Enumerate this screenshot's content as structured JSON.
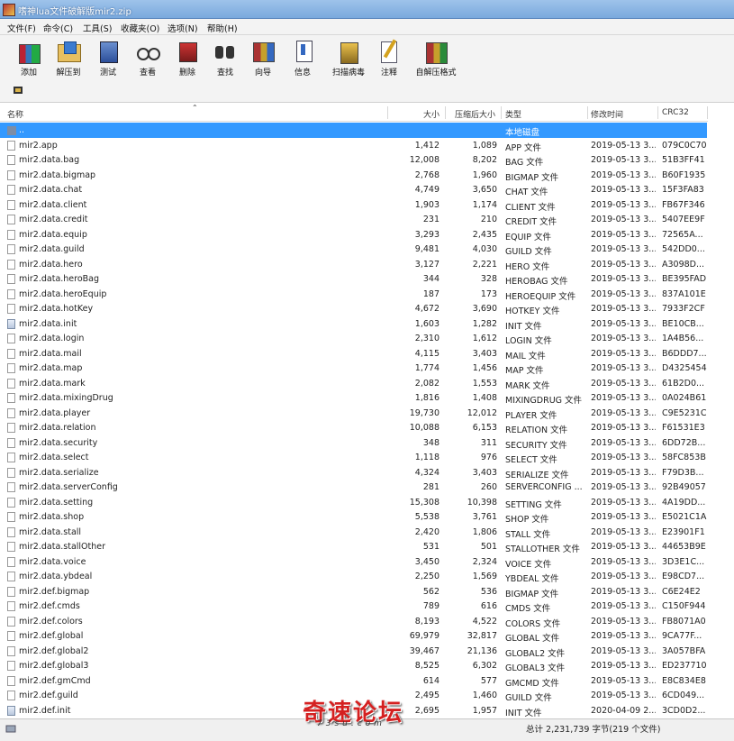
{
  "window": {
    "title": "嗜神lua文件破解版mir2.zip"
  },
  "menu": [
    "文件(F)",
    "命令(C)",
    "工具(S)",
    "收藏夹(O)",
    "选项(N)",
    "帮助(H)"
  ],
  "toolbar": [
    {
      "label": "添加",
      "icon": "add-icon"
    },
    {
      "label": "解压到",
      "icon": "extract-icon"
    },
    {
      "label": "测试",
      "icon": "test-icon"
    },
    {
      "label": "查看",
      "icon": "view-icon"
    },
    {
      "label": "删除",
      "icon": "delete-icon"
    },
    {
      "label": "查找",
      "icon": "find-icon"
    },
    {
      "label": "向导",
      "icon": "wizard-icon"
    },
    {
      "label": "信息",
      "icon": "info-icon"
    },
    {
      "label": "扫描病毒",
      "icon": "scan-virus-icon"
    },
    {
      "label": "注释",
      "icon": "comment-icon"
    },
    {
      "label": "自解压格式",
      "icon": "sfx-icon"
    }
  ],
  "columns": {
    "name": "名称",
    "size": "大小",
    "packed": "压缩后大小",
    "type": "类型",
    "modified": "修改时间",
    "crc": "CRC32"
  },
  "up_row": {
    "name": "..",
    "type": "本地磁盘"
  },
  "files": [
    {
      "name": "mir2.app",
      "size": "1,412",
      "packed": "1,089",
      "type": "APP 文件",
      "date": "2019-05-13 3...",
      "crc": "079C0C70"
    },
    {
      "name": "mir2.data.bag",
      "size": "12,008",
      "packed": "8,202",
      "type": "BAG 文件",
      "date": "2019-05-13 3...",
      "crc": "51B3FF41"
    },
    {
      "name": "mir2.data.bigmap",
      "size": "2,768",
      "packed": "1,960",
      "type": "BIGMAP 文件",
      "date": "2019-05-13 3...",
      "crc": "B60F1935"
    },
    {
      "name": "mir2.data.chat",
      "size": "4,749",
      "packed": "3,650",
      "type": "CHAT 文件",
      "date": "2019-05-13 3...",
      "crc": "15F3FA83"
    },
    {
      "name": "mir2.data.client",
      "size": "1,903",
      "packed": "1,174",
      "type": "CLIENT 文件",
      "date": "2019-05-13 3...",
      "crc": "FB67F346"
    },
    {
      "name": "mir2.data.credit",
      "size": "231",
      "packed": "210",
      "type": "CREDIT 文件",
      "date": "2019-05-13 3...",
      "crc": "5407EE9F"
    },
    {
      "name": "mir2.data.equip",
      "size": "3,293",
      "packed": "2,435",
      "type": "EQUIP 文件",
      "date": "2019-05-13 3...",
      "crc": "72565A..."
    },
    {
      "name": "mir2.data.guild",
      "size": "9,481",
      "packed": "4,030",
      "type": "GUILD 文件",
      "date": "2019-05-13 3...",
      "crc": "542DD0..."
    },
    {
      "name": "mir2.data.hero",
      "size": "3,127",
      "packed": "2,221",
      "type": "HERO 文件",
      "date": "2019-05-13 3...",
      "crc": "A3098D..."
    },
    {
      "name": "mir2.data.heroBag",
      "size": "344",
      "packed": "328",
      "type": "HEROBAG 文件",
      "date": "2019-05-13 3...",
      "crc": "BE395FAD"
    },
    {
      "name": "mir2.data.heroEquip",
      "size": "187",
      "packed": "173",
      "type": "HEROEQUIP 文件",
      "date": "2019-05-13 3...",
      "crc": "837A101E"
    },
    {
      "name": "mir2.data.hotKey",
      "size": "4,672",
      "packed": "3,690",
      "type": "HOTKEY 文件",
      "date": "2019-05-13 3...",
      "crc": "7933F2CF"
    },
    {
      "name": "mir2.data.init",
      "size": "1,603",
      "packed": "1,282",
      "type": "INIT 文件",
      "date": "2019-05-13 3...",
      "crc": "BE10CB...",
      "ini": true
    },
    {
      "name": "mir2.data.login",
      "size": "2,310",
      "packed": "1,612",
      "type": "LOGIN 文件",
      "date": "2019-05-13 3...",
      "crc": "1A4B56..."
    },
    {
      "name": "mir2.data.mail",
      "size": "4,115",
      "packed": "3,403",
      "type": "MAIL 文件",
      "date": "2019-05-13 3...",
      "crc": "B6DDD7..."
    },
    {
      "name": "mir2.data.map",
      "size": "1,774",
      "packed": "1,456",
      "type": "MAP 文件",
      "date": "2019-05-13 3...",
      "crc": "D4325454"
    },
    {
      "name": "mir2.data.mark",
      "size": "2,082",
      "packed": "1,553",
      "type": "MARK 文件",
      "date": "2019-05-13 3...",
      "crc": "61B2D0..."
    },
    {
      "name": "mir2.data.mixingDrug",
      "size": "1,816",
      "packed": "1,408",
      "type": "MIXINGDRUG 文件",
      "date": "2019-05-13 3...",
      "crc": "0A024B61"
    },
    {
      "name": "mir2.data.player",
      "size": "19,730",
      "packed": "12,012",
      "type": "PLAYER 文件",
      "date": "2019-05-13 3...",
      "crc": "C9E5231C"
    },
    {
      "name": "mir2.data.relation",
      "size": "10,088",
      "packed": "6,153",
      "type": "RELATION 文件",
      "date": "2019-05-13 3...",
      "crc": "F61531E3"
    },
    {
      "name": "mir2.data.security",
      "size": "348",
      "packed": "311",
      "type": "SECURITY 文件",
      "date": "2019-05-13 3...",
      "crc": "6DD72B..."
    },
    {
      "name": "mir2.data.select",
      "size": "1,118",
      "packed": "976",
      "type": "SELECT 文件",
      "date": "2019-05-13 3...",
      "crc": "58FC853B"
    },
    {
      "name": "mir2.data.serialize",
      "size": "4,324",
      "packed": "3,403",
      "type": "SERIALIZE 文件",
      "date": "2019-05-13 3...",
      "crc": "F79D3B..."
    },
    {
      "name": "mir2.data.serverConfig",
      "size": "281",
      "packed": "260",
      "type": "SERVERCONFIG ...",
      "date": "2019-05-13 3...",
      "crc": "92B49057"
    },
    {
      "name": "mir2.data.setting",
      "size": "15,308",
      "packed": "10,398",
      "type": "SETTING 文件",
      "date": "2019-05-13 3...",
      "crc": "4A19DD..."
    },
    {
      "name": "mir2.data.shop",
      "size": "5,538",
      "packed": "3,761",
      "type": "SHOP 文件",
      "date": "2019-05-13 3...",
      "crc": "E5021C1A"
    },
    {
      "name": "mir2.data.stall",
      "size": "2,420",
      "packed": "1,806",
      "type": "STALL 文件",
      "date": "2019-05-13 3...",
      "crc": "E23901F1"
    },
    {
      "name": "mir2.data.stallOther",
      "size": "531",
      "packed": "501",
      "type": "STALLOTHER 文件",
      "date": "2019-05-13 3...",
      "crc": "44653B9E"
    },
    {
      "name": "mir2.data.voice",
      "size": "3,450",
      "packed": "2,324",
      "type": "VOICE 文件",
      "date": "2019-05-13 3...",
      "crc": "3D3E1C..."
    },
    {
      "name": "mir2.data.ybdeal",
      "size": "2,250",
      "packed": "1,569",
      "type": "YBDEAL 文件",
      "date": "2019-05-13 3...",
      "crc": "E98CD7..."
    },
    {
      "name": "mir2.def.bigmap",
      "size": "562",
      "packed": "536",
      "type": "BIGMAP 文件",
      "date": "2019-05-13 3...",
      "crc": "C6E24E2"
    },
    {
      "name": "mir2.def.cmds",
      "size": "789",
      "packed": "616",
      "type": "CMDS 文件",
      "date": "2019-05-13 3...",
      "crc": "C150F944"
    },
    {
      "name": "mir2.def.colors",
      "size": "8,193",
      "packed": "4,522",
      "type": "COLORS 文件",
      "date": "2019-05-13 3...",
      "crc": "FB8071A0"
    },
    {
      "name": "mir2.def.global",
      "size": "69,979",
      "packed": "32,817",
      "type": "GLOBAL 文件",
      "date": "2019-05-13 3...",
      "crc": "9CA77F..."
    },
    {
      "name": "mir2.def.global2",
      "size": "39,467",
      "packed": "21,136",
      "type": "GLOBAL2 文件",
      "date": "2019-05-13 3...",
      "crc": "3A057BFA"
    },
    {
      "name": "mir2.def.global3",
      "size": "8,525",
      "packed": "6,302",
      "type": "GLOBAL3 文件",
      "date": "2019-05-13 3...",
      "crc": "ED237710"
    },
    {
      "name": "mir2.def.gmCmd",
      "size": "614",
      "packed": "577",
      "type": "GMCMD 文件",
      "date": "2019-05-13 3...",
      "crc": "E8C834E8"
    },
    {
      "name": "mir2.def.guild",
      "size": "2,495",
      "packed": "1,460",
      "type": "GUILD 文件",
      "date": "2019-05-13 3...",
      "crc": "6CD049..."
    },
    {
      "name": "mir2.def.init",
      "size": "2,695",
      "packed": "1,957",
      "type": "INIT 文件",
      "date": "2020-04-09 2...",
      "crc": "3CD0D2...",
      "ini": true
    }
  ],
  "status": {
    "right": "总计 2,231,739 字节(219 个文件)"
  },
  "watermark": {
    "main": "奇速论坛",
    "sub": "73su.com"
  },
  "colors": {
    "selection": "#3399ff",
    "titlebar": "#7aa9dd",
    "watermark": "#d42020"
  }
}
